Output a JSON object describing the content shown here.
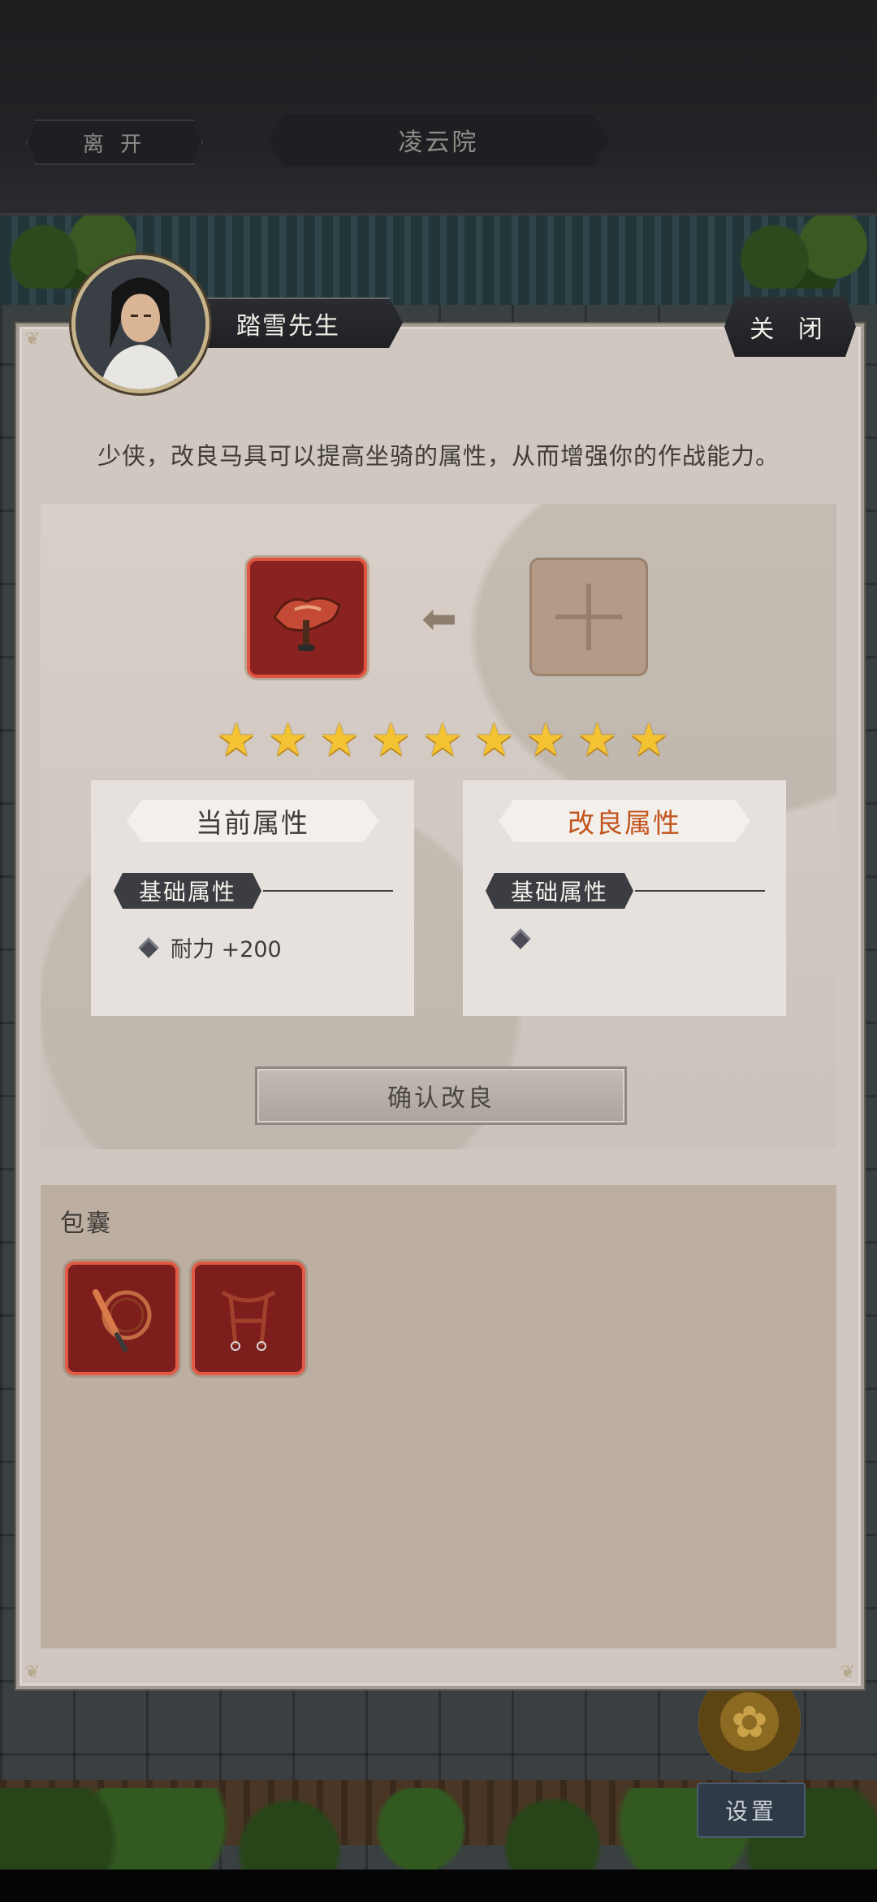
{
  "topbar": {
    "leave_label": "离 开",
    "place_name": "凌云院"
  },
  "hud": {
    "settings_label": "设置"
  },
  "dialog": {
    "npc_name": "踏雪先生",
    "close_label": "关 闭",
    "description": "少侠，改良马具可以提高坐骑的属性，从而增强你的作战能力。",
    "star_count": 9,
    "current_panel": {
      "title": "当前属性",
      "section": "基础属性",
      "attribute": "耐力 +200"
    },
    "improved_panel": {
      "title": "改良属性",
      "section": "基础属性",
      "attribute": ""
    },
    "confirm_label": "确认改良",
    "bag_label": "包囊"
  },
  "icons": {
    "equipped_item": "saddle-icon",
    "add_slot": "plus-icon",
    "arrow": "arrow-left-icon",
    "bag_items": [
      "whip-icon",
      "bridle-icon"
    ]
  },
  "colors": {
    "improved_title": "#c2541d",
    "item_border": "#e0553f",
    "star": "#f3c333"
  }
}
